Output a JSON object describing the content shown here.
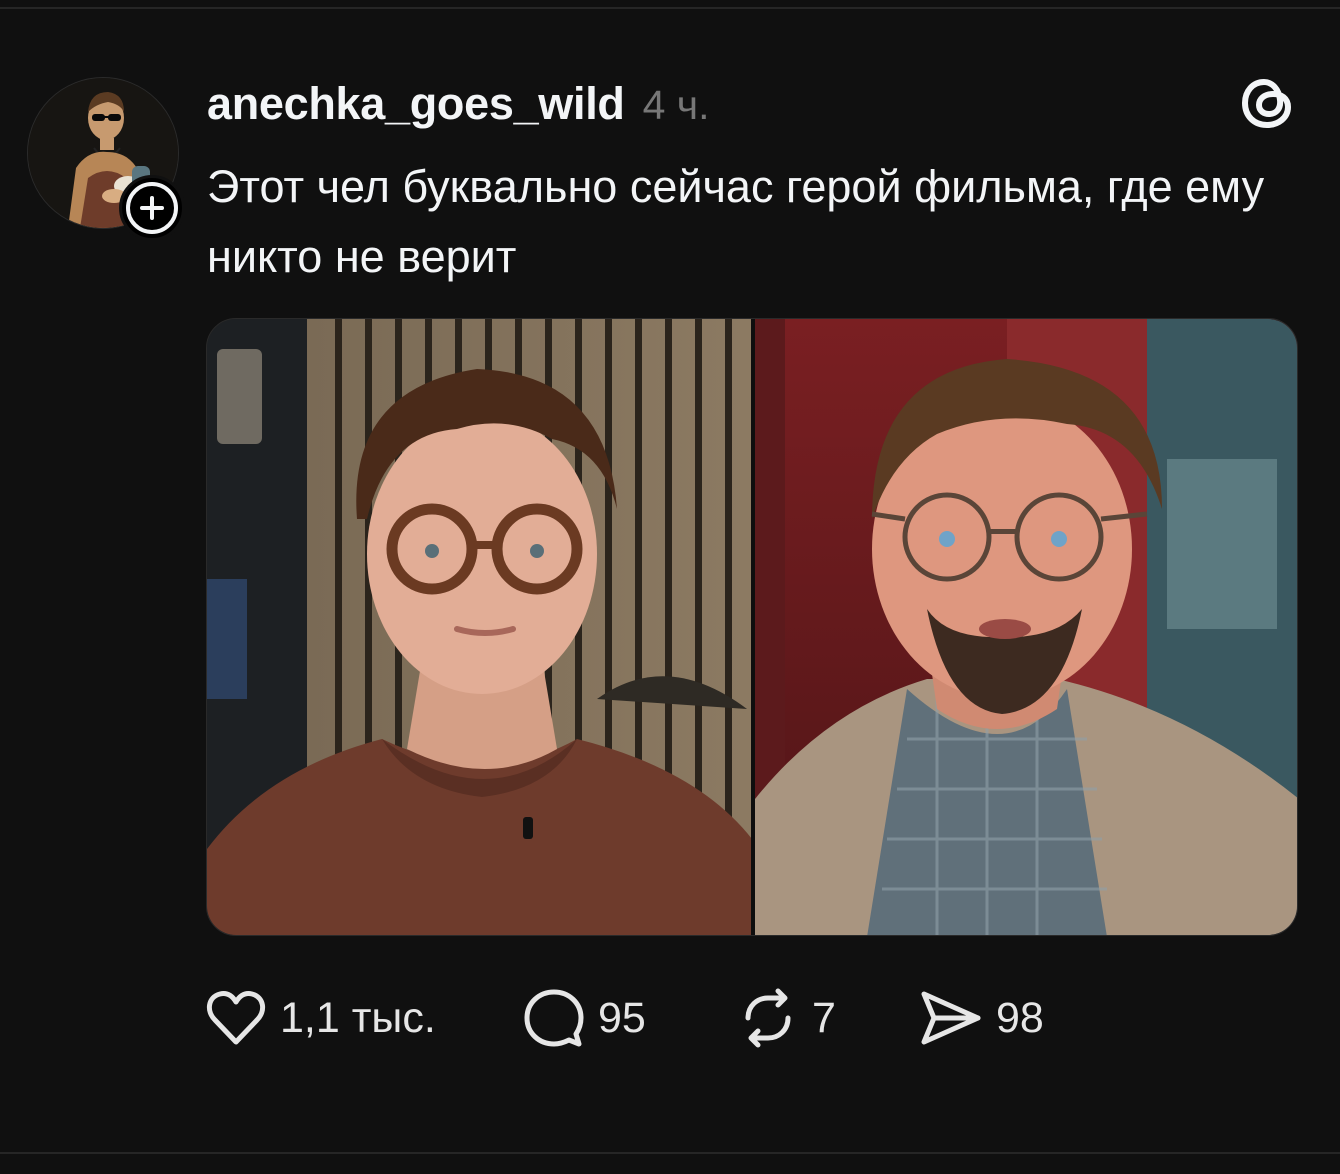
{
  "post": {
    "author": {
      "username": "anechka_goes_wild",
      "avatar_icon": "avatar-portrait-icon",
      "follow_icon": "plus-icon"
    },
    "time": "4 ч.",
    "app_icon": "threads-logo-icon",
    "text": "Этот чел буквально сейчас герой фильма, где ему никто не верит",
    "media": {
      "layout": "two-photo-collage",
      "left_photo": "man-in-glasses-brown-sweater",
      "right_photo": "man-in-glasses-beige-jacket"
    },
    "actions": {
      "like": {
        "icon": "heart-icon",
        "count": "1,1 тыс."
      },
      "reply": {
        "icon": "comment-bubble-icon",
        "count": "95"
      },
      "repost": {
        "icon": "repost-icon",
        "count": "7"
      },
      "share": {
        "icon": "send-icon",
        "count": "98"
      }
    }
  },
  "colors": {
    "background": "#101010",
    "primary_text": "#f3f5f7",
    "secondary_text": "#777777",
    "divider": "#262626"
  }
}
